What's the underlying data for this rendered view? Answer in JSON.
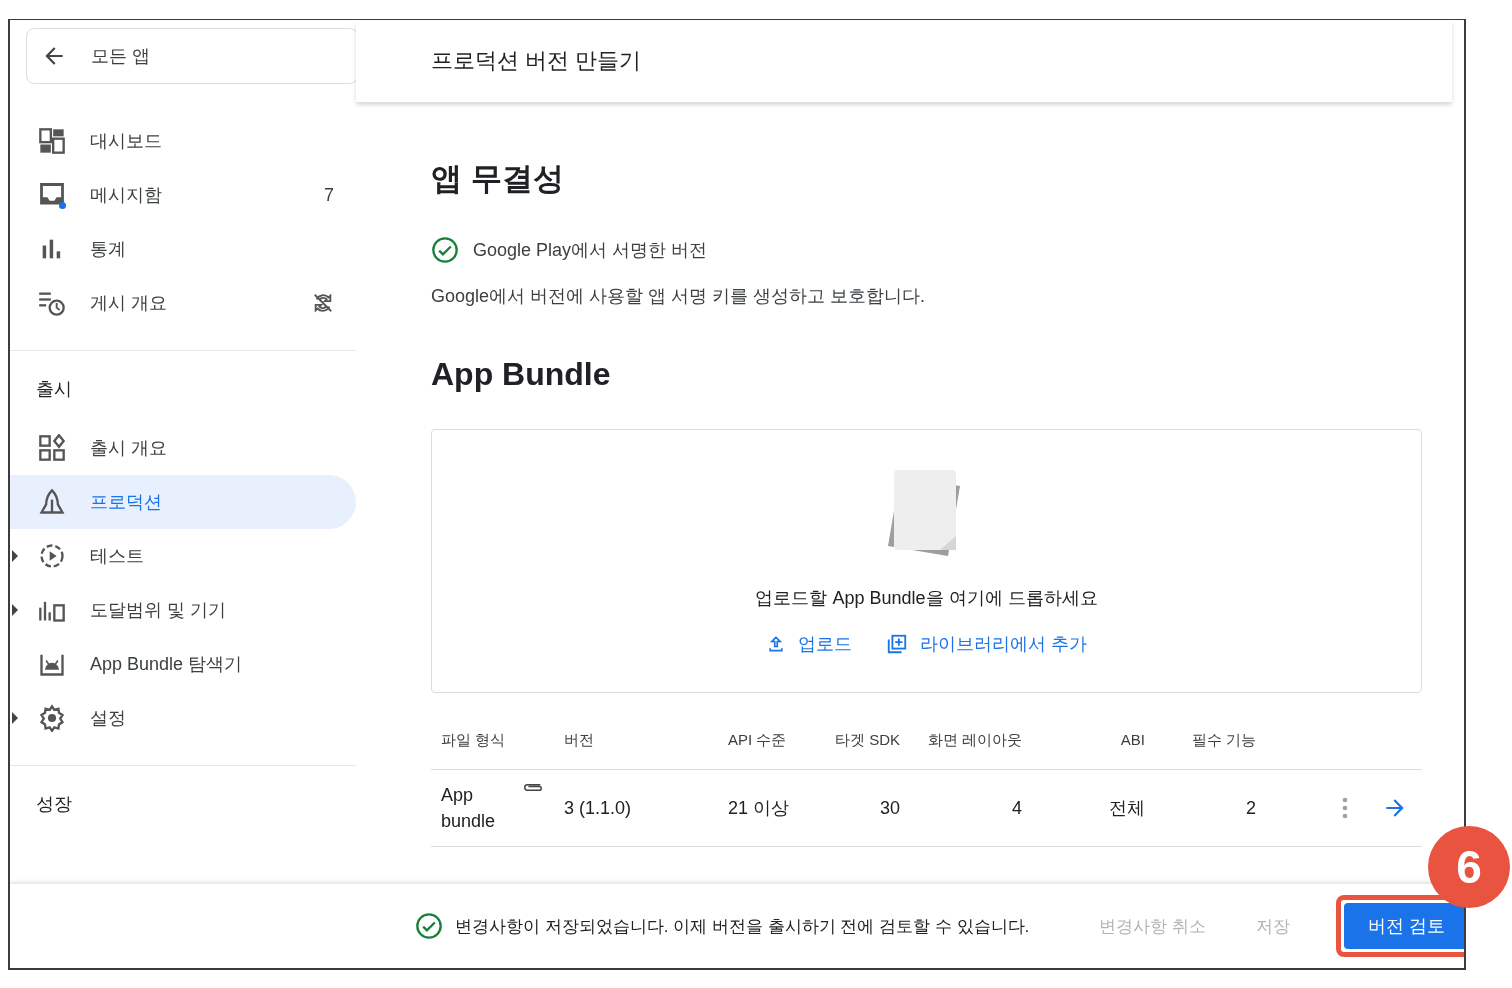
{
  "sidebar": {
    "back_label": "모든 앱",
    "groups": [
      {
        "items": [
          {
            "label": "대시보드",
            "kind": "dashboard",
            "selected": false,
            "expandable": false
          },
          {
            "label": "메시지함",
            "kind": "inbox",
            "badge": "7",
            "selected": false,
            "expandable": false
          },
          {
            "label": "통계",
            "kind": "stats",
            "selected": false,
            "expandable": false
          },
          {
            "label": "게시 개요",
            "kind": "schedule",
            "selected": false,
            "expandable": false
          }
        ]
      },
      {
        "title": "출시",
        "items": [
          {
            "label": "출시 개요",
            "kind": "releases",
            "selected": false,
            "expandable": false
          },
          {
            "label": "프로덕션",
            "kind": "production",
            "selected": true,
            "expandable": false
          },
          {
            "label": "테스트",
            "kind": "test",
            "selected": false,
            "expandable": true
          },
          {
            "label": "도달범위 및 기기",
            "kind": "reach",
            "selected": false,
            "expandable": true
          },
          {
            "label": "App Bundle 탐색기",
            "kind": "bundle",
            "selected": false,
            "expandable": false
          },
          {
            "label": "설정",
            "kind": "settings",
            "selected": false,
            "expandable": true
          }
        ]
      },
      {
        "title": "성장"
      }
    ]
  },
  "header": {
    "title": "프로덕션 버전 만들기"
  },
  "integrity": {
    "heading": "앱 무결성",
    "status": "Google Play에서 서명한 버전",
    "description": "Google에서 버전에 사용할 앱 서명 키를 생성하고 보호합니다."
  },
  "bundle": {
    "heading": "App Bundle",
    "drop_text": "업로드할 App Bundle을 여기에 드롭하세요",
    "actions": [
      {
        "label": "업로드",
        "kind": "upload"
      },
      {
        "label": "라이브러리에서 추가",
        "kind": "library"
      }
    ]
  },
  "table": {
    "columns": [
      "파일 형식",
      "버전",
      "API 수준",
      "타겟 SDK",
      "화면 레이아웃",
      "ABI",
      "필수 기능"
    ],
    "rows": [
      {
        "cells": [
          "App bundle",
          "3 (1.1.0)",
          "21 이상",
          "30",
          "4",
          "전체",
          "2"
        ]
      }
    ]
  },
  "footer": {
    "message": "변경사항이 저장되었습니다. 이제 버전을 출시하기 전에 검토할 수 있습니다.",
    "buttons": [
      {
        "label": "변경사항 취소",
        "kind": "text",
        "disabled": true
      },
      {
        "label": "저장",
        "kind": "text",
        "disabled": true
      },
      {
        "label": "버전 검토",
        "kind": "primary",
        "disabled": false
      }
    ]
  },
  "annotation": {
    "label": "6"
  }
}
